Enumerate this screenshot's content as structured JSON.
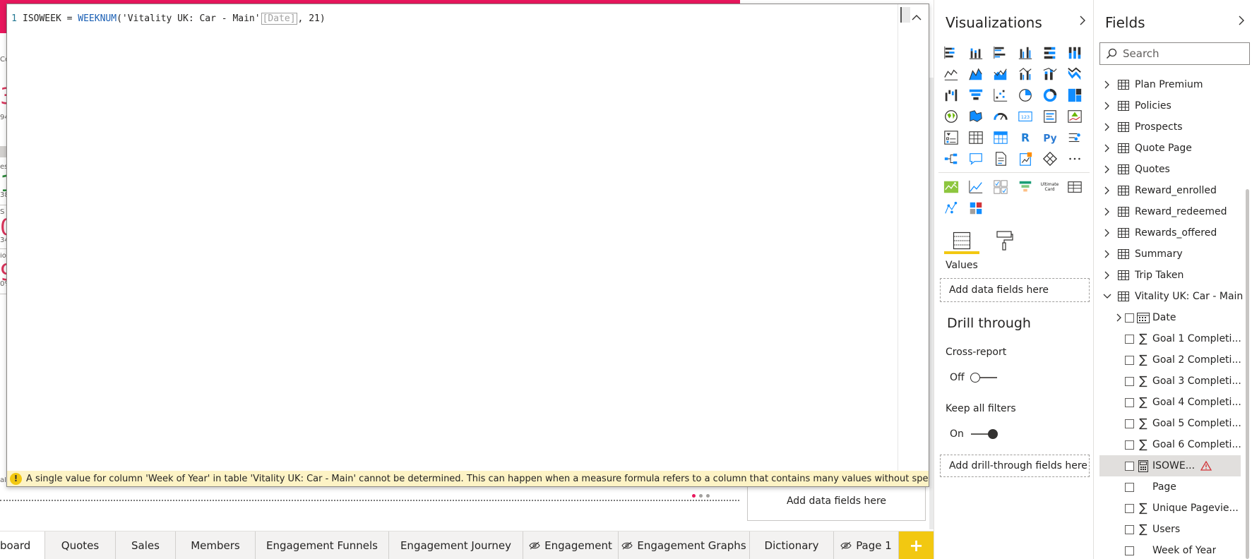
{
  "canvas": {
    "peek_labels": [
      "Co",
      "94",
      "es",
      "38",
      "S",
      "34",
      "io",
      "0%",
      "al"
    ],
    "peek_numbers": [
      "3",
      "1",
      "0",
      "9"
    ],
    "pagination_dot_colors": [
      "#e8175d",
      "#a19f9d",
      "#a19f9d"
    ],
    "drop_label": "Add data fields here"
  },
  "editor": {
    "line_number": "1",
    "code": {
      "measure_name": "ISOWEEK = ",
      "function": "WEEKNUM",
      "open": "(",
      "table": "'Vitality UK: Car - Main'",
      "column": "[Date]",
      "rest": ", 21)"
    },
    "error_message": "A single value for column 'Week of Year' in table 'Vitality UK: Car - Main' cannot be determined. This can happen when a measure formula refers to a column that contains many values without specifying an aggre"
  },
  "visualizations": {
    "title": "Visualizations",
    "values_label": "Values",
    "values_placeholder": "Add data fields here",
    "drill_title": "Drill through",
    "cross_report_label": "Cross-report",
    "cross_report_state": "Off",
    "keep_filters_label": "Keep all filters",
    "keep_filters_state": "On",
    "drill_placeholder": "Add drill-through fields here",
    "accent_color": "#f2c811",
    "icons": [
      "stacked-bar-chart-icon",
      "stacked-column-chart-icon",
      "clustered-bar-chart-icon",
      "clustered-column-chart-icon",
      "100-stacked-bar-chart-icon",
      "100-stacked-column-chart-icon",
      "line-chart-icon",
      "area-chart-icon",
      "stacked-area-chart-icon",
      "line-clustered-column-chart-icon",
      "line-stacked-column-chart-icon",
      "ribbon-chart-icon",
      "waterfall-chart-icon",
      "funnel-chart-icon",
      "scatter-chart-icon",
      "pie-chart-icon",
      "donut-chart-icon",
      "treemap-icon",
      "map-icon",
      "filled-map-icon",
      "gauge-icon",
      "card-icon",
      "multi-row-card-icon",
      "kpi-icon",
      "slicer-icon",
      "table-icon",
      "matrix-icon",
      "r-visual-icon",
      "python-visual-icon",
      "key-influencers-icon",
      "decomposition-tree-icon",
      "qa-icon",
      "smart-narrative-icon",
      "paginated-report-icon",
      "power-apps-icon",
      "more-visuals-icon"
    ],
    "custom_icons": [
      "custom-image-visual-icon",
      "custom-line-visual-icon",
      "custom-grid-visual-icon",
      "custom-funnel-visual-icon",
      "ultimate-card-icon",
      "custom-table-visual-icon",
      "custom-scatter-visual-icon",
      "custom-tiles-visual-icon"
    ],
    "ultimate_card_text": "Ultimate Card"
  },
  "fields": {
    "title": "Fields",
    "search_placeholder": "Search",
    "tables": [
      {
        "name": "Plan Premium"
      },
      {
        "name": "Policies"
      },
      {
        "name": "Prospects"
      },
      {
        "name": "Quote Page"
      },
      {
        "name": "Quotes"
      },
      {
        "name": "Reward_enrolled"
      },
      {
        "name": "Reward_redeemed"
      },
      {
        "name": "Rewards_offered"
      },
      {
        "name": "Summary"
      },
      {
        "name": "Trip Taken"
      },
      {
        "name": "Vitality UK: Car - Main"
      }
    ],
    "items": [
      {
        "name": "Date",
        "icon": "calendar-icon"
      },
      {
        "name": "Goal 1 Completi...",
        "icon": "sum-icon"
      },
      {
        "name": "Goal 2 Completi...",
        "icon": "sum-icon"
      },
      {
        "name": "Goal 3 Completi...",
        "icon": "sum-icon"
      },
      {
        "name": "Goal 4 Completi...",
        "icon": "sum-icon"
      },
      {
        "name": "Goal 5 Completi...",
        "icon": "sum-icon"
      },
      {
        "name": "Goal 6 Completi...",
        "icon": "sum-icon"
      },
      {
        "name": "ISOWE...",
        "icon": "measure-icon"
      },
      {
        "name": "Page",
        "icon": ""
      },
      {
        "name": "Unique Pagevie...",
        "icon": "sum-icon"
      },
      {
        "name": "Users",
        "icon": "sum-icon"
      },
      {
        "name": "Week of Year",
        "icon": ""
      }
    ],
    "warning_color": "#d13438"
  },
  "page_tabs": {
    "tabs": [
      {
        "label": "board",
        "hidden": false
      },
      {
        "label": "Quotes",
        "hidden": false
      },
      {
        "label": "Sales",
        "hidden": false
      },
      {
        "label": "Members",
        "hidden": false
      },
      {
        "label": "Engagement Funnels",
        "hidden": false
      },
      {
        "label": "Engagement Journey",
        "hidden": false
      },
      {
        "label": "Engagement",
        "hidden": true
      },
      {
        "label": "Engagement Graphs",
        "hidden": true
      },
      {
        "label": "Dictionary",
        "hidden": false
      },
      {
        "label": "Page 1",
        "hidden": true
      }
    ],
    "add_label": "+"
  }
}
